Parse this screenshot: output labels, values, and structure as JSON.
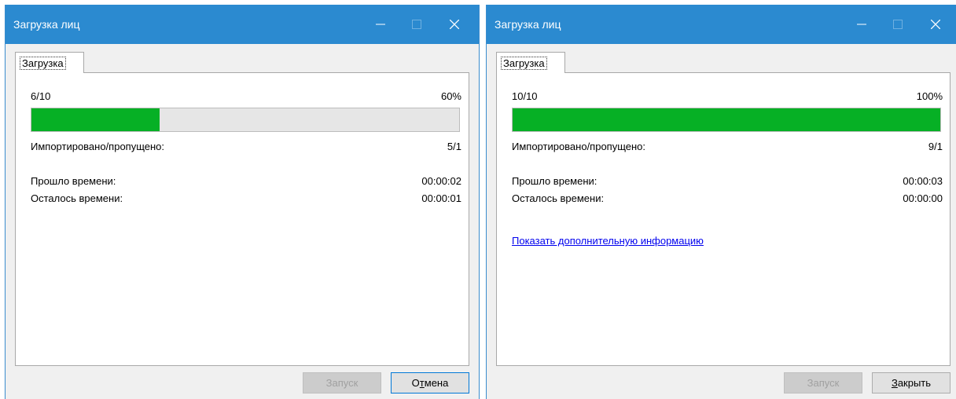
{
  "windows": [
    {
      "title": "Загрузка лиц",
      "tab_label": "Загрузка",
      "progress_text": "6/10",
      "progress_percent_text": "60%",
      "progress_value": 0.3,
      "imported_label": "Импортировано/пропущено:",
      "imported_value": "5/1",
      "elapsed_label": "Прошло времени:",
      "elapsed_value": "00:00:02",
      "remaining_label": "Осталось времени:",
      "remaining_value": "00:00:01",
      "start_button": "Запуск",
      "action_button_pre": "О",
      "action_button_u": "т",
      "action_button_post": "мена"
    },
    {
      "title": "Загрузка лиц",
      "tab_label": "Загрузка",
      "progress_text": "10/10",
      "progress_percent_text": "100%",
      "progress_value": 1.0,
      "imported_label": "Импортировано/пропущено:",
      "imported_value": "9/1",
      "elapsed_label": "Прошло времени:",
      "elapsed_value": "00:00:03",
      "remaining_label": "Осталось времени:",
      "remaining_value": "00:00:00",
      "more_info_link": "Показать дополнительную информацию",
      "start_button": "Запуск",
      "action_button_pre": "",
      "action_button_u": "З",
      "action_button_post": "акрыть"
    }
  ],
  "colors": {
    "titlebar": "#2b8ad0",
    "progress_fill": "#06b025",
    "link": "#0000ee"
  },
  "icons": [
    "minimize-icon",
    "maximize-icon",
    "close-icon"
  ]
}
